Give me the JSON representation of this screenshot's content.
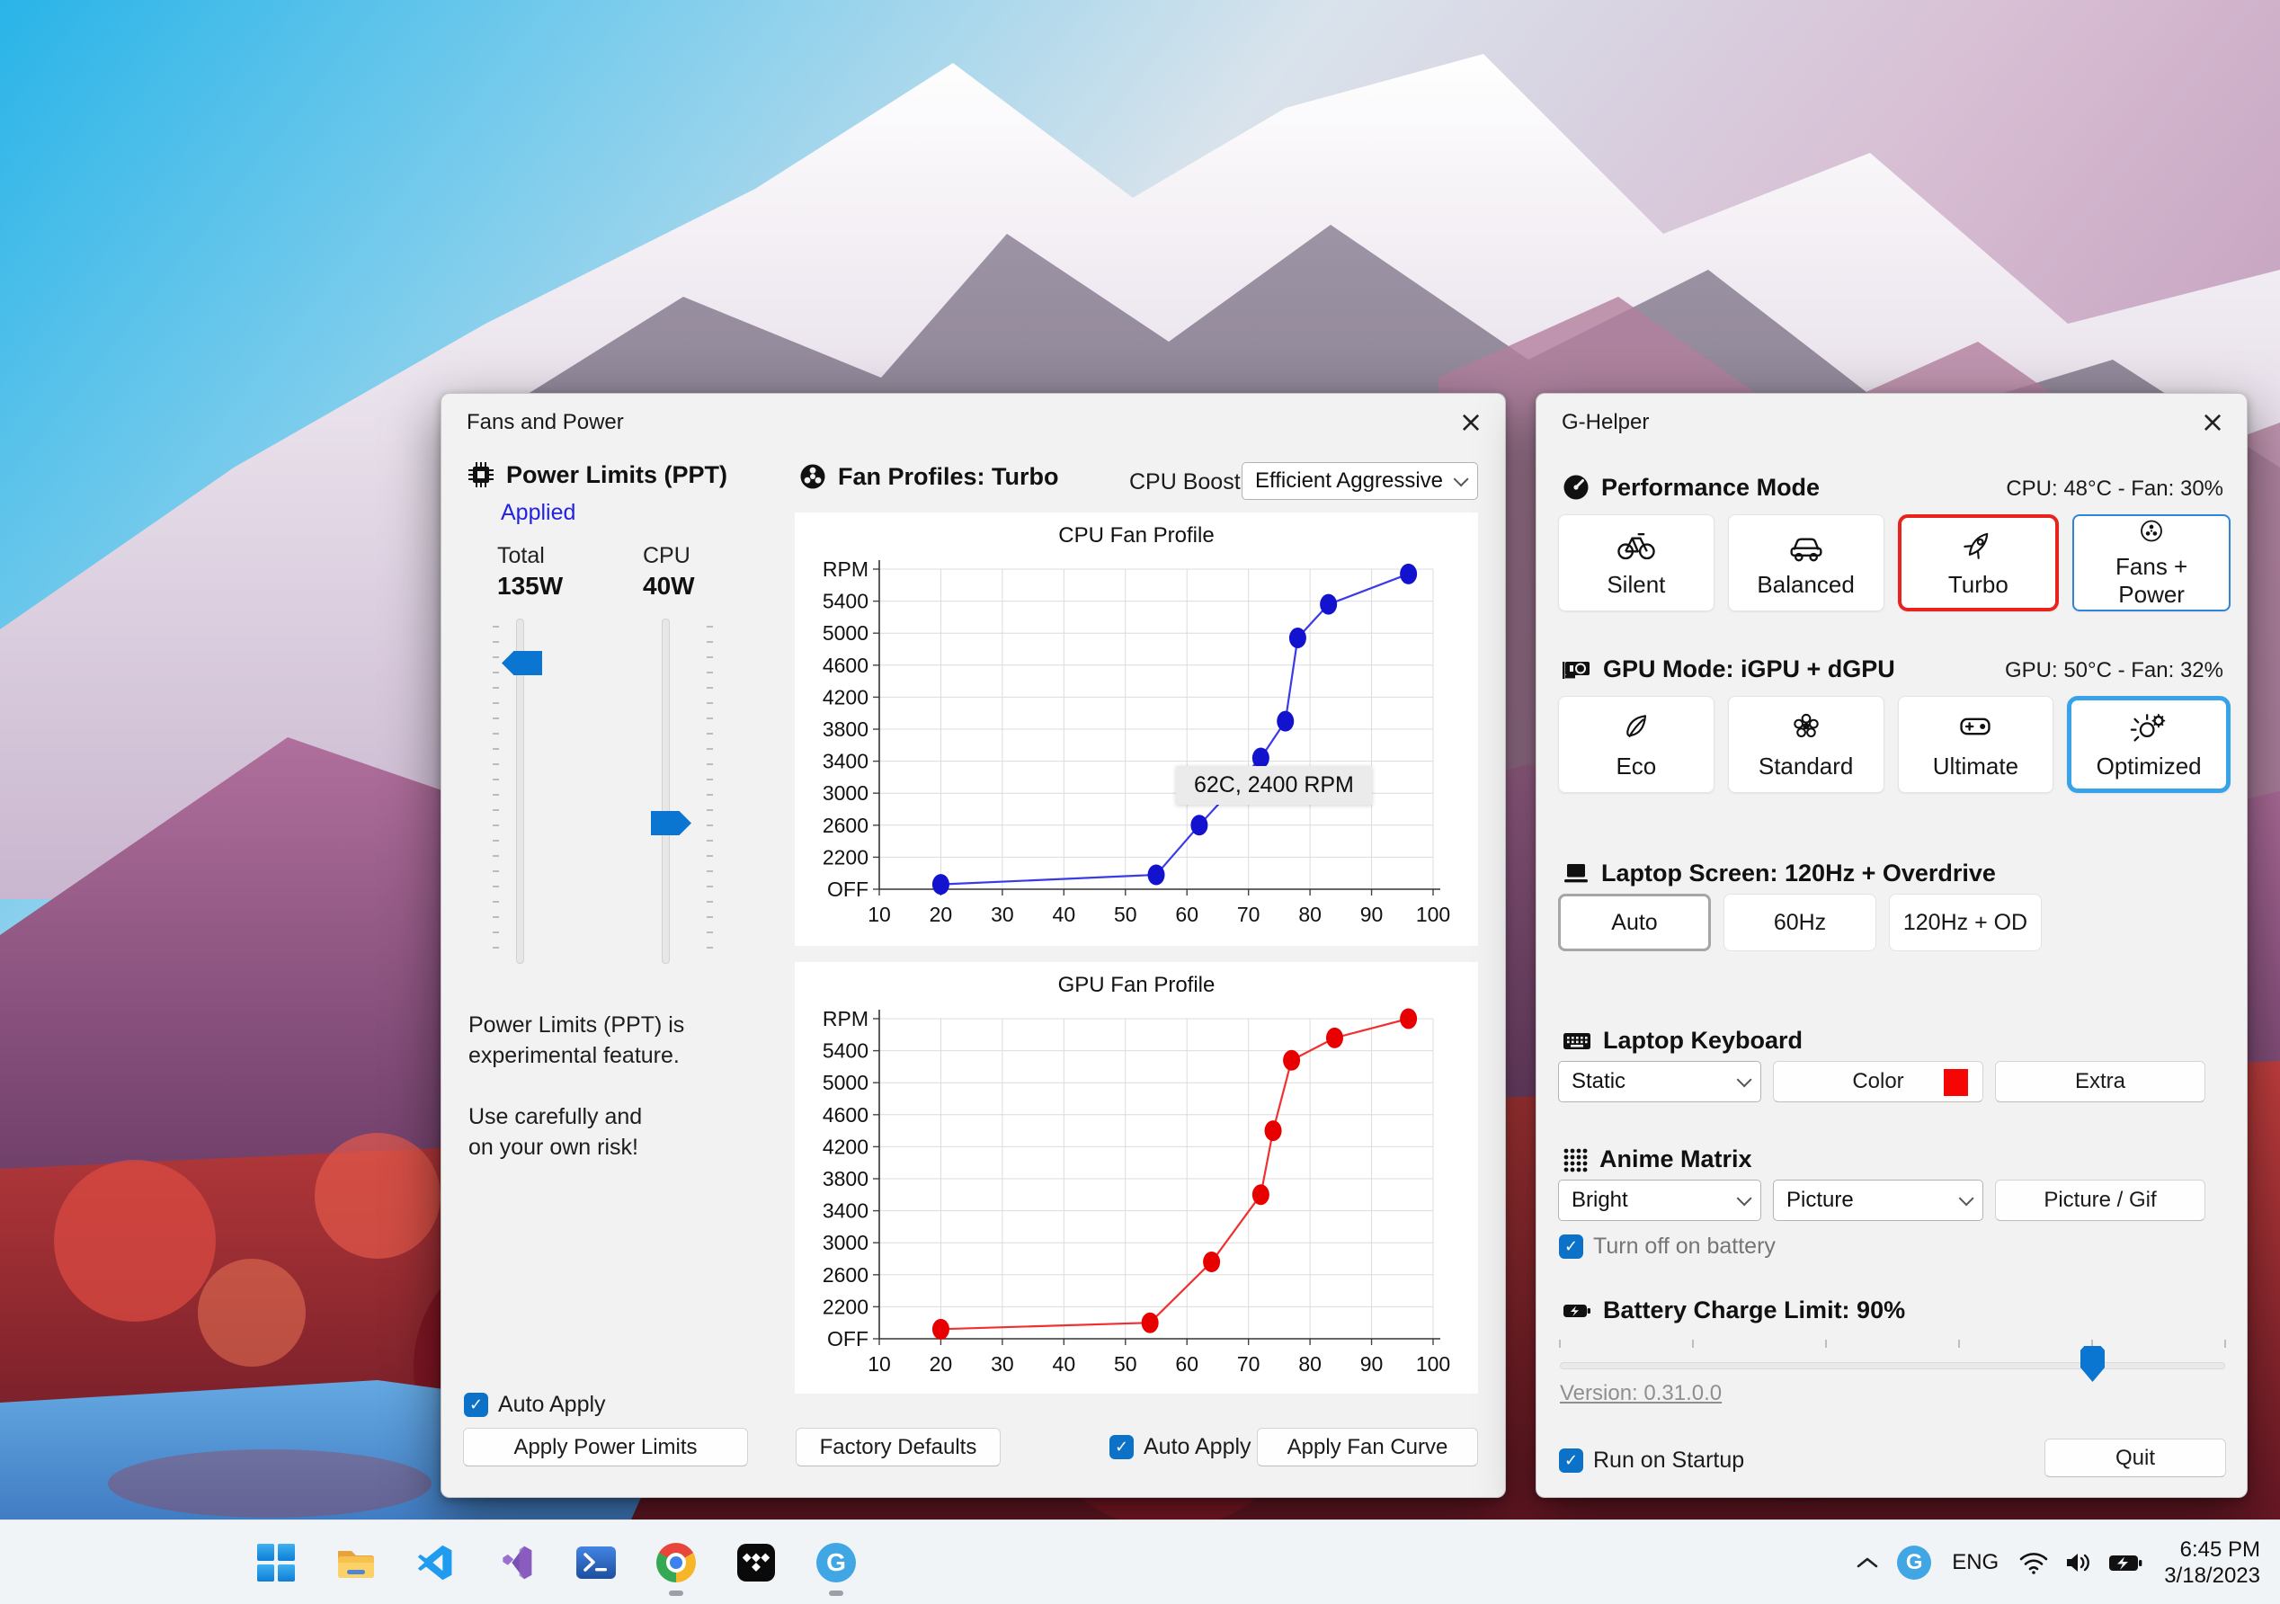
{
  "fans_window": {
    "title": "Fans and Power",
    "power_limits": {
      "header": "Power Limits (PPT)",
      "status": "Applied",
      "total_label": "Total",
      "total_value": "135W",
      "cpu_label": "CPU",
      "cpu_value": "40W",
      "note_line1": "Power Limits (PPT) is",
      "note_line2": "experimental feature.",
      "note_line3": "Use carefully and",
      "note_line4": "on your own risk!",
      "auto_apply_label": "Auto Apply",
      "apply_button": "Apply Power Limits"
    },
    "fan_profiles": {
      "header": "Fan Profiles: Turbo",
      "cpu_boost_label": "CPU Boost",
      "cpu_boost_value": "Efficient Aggressive",
      "factory_defaults_button": "Factory Defaults",
      "auto_apply_label": "Auto Apply",
      "apply_fan_curve_button": "Apply Fan Curve"
    }
  },
  "chart_data": [
    {
      "type": "line",
      "title": "CPU Fan Profile",
      "line_color": "#3a3ae8",
      "point_color": "#1212cf",
      "x_ticks": [
        10,
        20,
        30,
        40,
        50,
        60,
        70,
        80,
        90,
        100
      ],
      "y_tick_labels": [
        "OFF",
        "2200",
        "2600",
        "3000",
        "3400",
        "3800",
        "4200",
        "4600",
        "5000",
        "5400",
        "RPM"
      ],
      "grid": true,
      "legend": "none",
      "points": [
        {
          "temp_c": 20,
          "rpm": 1900,
          "y_unit": 0.15
        },
        {
          "temp_c": 55,
          "rpm": 2000,
          "y_unit": 0.45
        },
        {
          "temp_c": 62,
          "rpm": 2600,
          "y_unit": 2.0
        },
        {
          "temp_c": 72,
          "rpm": 3450,
          "y_unit": 4.1
        },
        {
          "temp_c": 76,
          "rpm": 3900,
          "y_unit": 5.25
        },
        {
          "temp_c": 78,
          "rpm": 4950,
          "y_unit": 7.85
        },
        {
          "temp_c": 83,
          "rpm": 5350,
          "y_unit": 8.9
        },
        {
          "temp_c": 96,
          "rpm": 5750,
          "y_unit": 9.85
        }
      ],
      "tooltip": "62C, 2400 RPM"
    },
    {
      "type": "line",
      "title": "GPU Fan Profile",
      "line_color": "#f03030",
      "point_color": "#e80000",
      "x_ticks": [
        10,
        20,
        30,
        40,
        50,
        60,
        70,
        80,
        90,
        100
      ],
      "y_tick_labels": [
        "OFF",
        "2200",
        "2600",
        "3000",
        "3400",
        "3800",
        "4200",
        "4600",
        "5000",
        "5400",
        "RPM"
      ],
      "grid": true,
      "legend": "none",
      "points": [
        {
          "temp_c": 20,
          "rpm": 1950,
          "y_unit": 0.3
        },
        {
          "temp_c": 54,
          "rpm": 2000,
          "y_unit": 0.5
        },
        {
          "temp_c": 64,
          "rpm": 2750,
          "y_unit": 2.4
        },
        {
          "temp_c": 72,
          "rpm": 3600,
          "y_unit": 4.5
        },
        {
          "temp_c": 74,
          "rpm": 4400,
          "y_unit": 6.5
        },
        {
          "temp_c": 77,
          "rpm": 5270,
          "y_unit": 8.7
        },
        {
          "temp_c": 84,
          "rpm": 5560,
          "y_unit": 9.4
        },
        {
          "temp_c": 96,
          "rpm": 5900,
          "y_unit": 10.0
        }
      ],
      "tooltip": ""
    }
  ],
  "ghelper_window": {
    "title": "G-Helper",
    "performance": {
      "header": "Performance Mode",
      "status": "CPU: 48°C -  Fan: 30%",
      "modes": [
        {
          "label": "Silent",
          "icon": "bicycle-icon"
        },
        {
          "label": "Balanced",
          "icon": "car-icon"
        },
        {
          "label": "Turbo",
          "icon": "rocket-icon",
          "selected": true
        },
        {
          "label": "Fans + Power",
          "icon": "fan-icon",
          "outlined": true
        }
      ]
    },
    "gpu": {
      "header": "GPU Mode: iGPU + dGPU",
      "status": "GPU: 50°C -  Fan: 32%",
      "modes": [
        {
          "label": "Eco",
          "icon": "leaf-icon"
        },
        {
          "label": "Standard",
          "icon": "flower-icon"
        },
        {
          "label": "Ultimate",
          "icon": "gamepad-icon"
        },
        {
          "label": "Optimized",
          "icon": "gear-bulb-icon",
          "selected": true
        }
      ]
    },
    "screen": {
      "header": "Laptop Screen: 120Hz + Overdrive",
      "options": [
        {
          "label": "Auto",
          "selected": true
        },
        {
          "label": "60Hz"
        },
        {
          "label": "120Hz + OD"
        }
      ]
    },
    "keyboard": {
      "header": "Laptop Keyboard",
      "mode_value": "Static",
      "color_button": "Color",
      "color_swatch": "#f60505",
      "extra_button": "Extra"
    },
    "anime_matrix": {
      "header": "Anime Matrix",
      "brightness_value": "Bright",
      "mode_value": "Picture",
      "picture_gif_button": "Picture / Gif",
      "battery_checkbox_label": "Turn off on battery",
      "battery_checkbox_checked": true
    },
    "battery": {
      "header": "Battery Charge Limit: 90%",
      "slider_percent": 80
    },
    "version_link": "Version: 0.31.0.0",
    "run_on_startup_label": "Run on Startup",
    "quit_button": "Quit"
  },
  "taskbar": {
    "icons": [
      {
        "name": "start-icon"
      },
      {
        "name": "file-explorer-icon"
      },
      {
        "name": "vscode-icon"
      },
      {
        "name": "visual-studio-icon"
      },
      {
        "name": "powershell-icon"
      },
      {
        "name": "chrome-icon",
        "running": true
      },
      {
        "name": "tidal-icon"
      },
      {
        "name": "g-helper-icon",
        "running": true
      }
    ],
    "tray": {
      "language": "ENG",
      "time": "6:45 PM",
      "date": "3/18/2023"
    }
  },
  "colors": {
    "accent_blue": "#0b76d1",
    "applied_blue": "#2222e0",
    "selected_red_border": "#e8231e",
    "selected_blue_border": "#38a3e8",
    "keyboard_swatch_red": "#f60505"
  },
  "check_glyph": "✓",
  "close_glyph": "×"
}
